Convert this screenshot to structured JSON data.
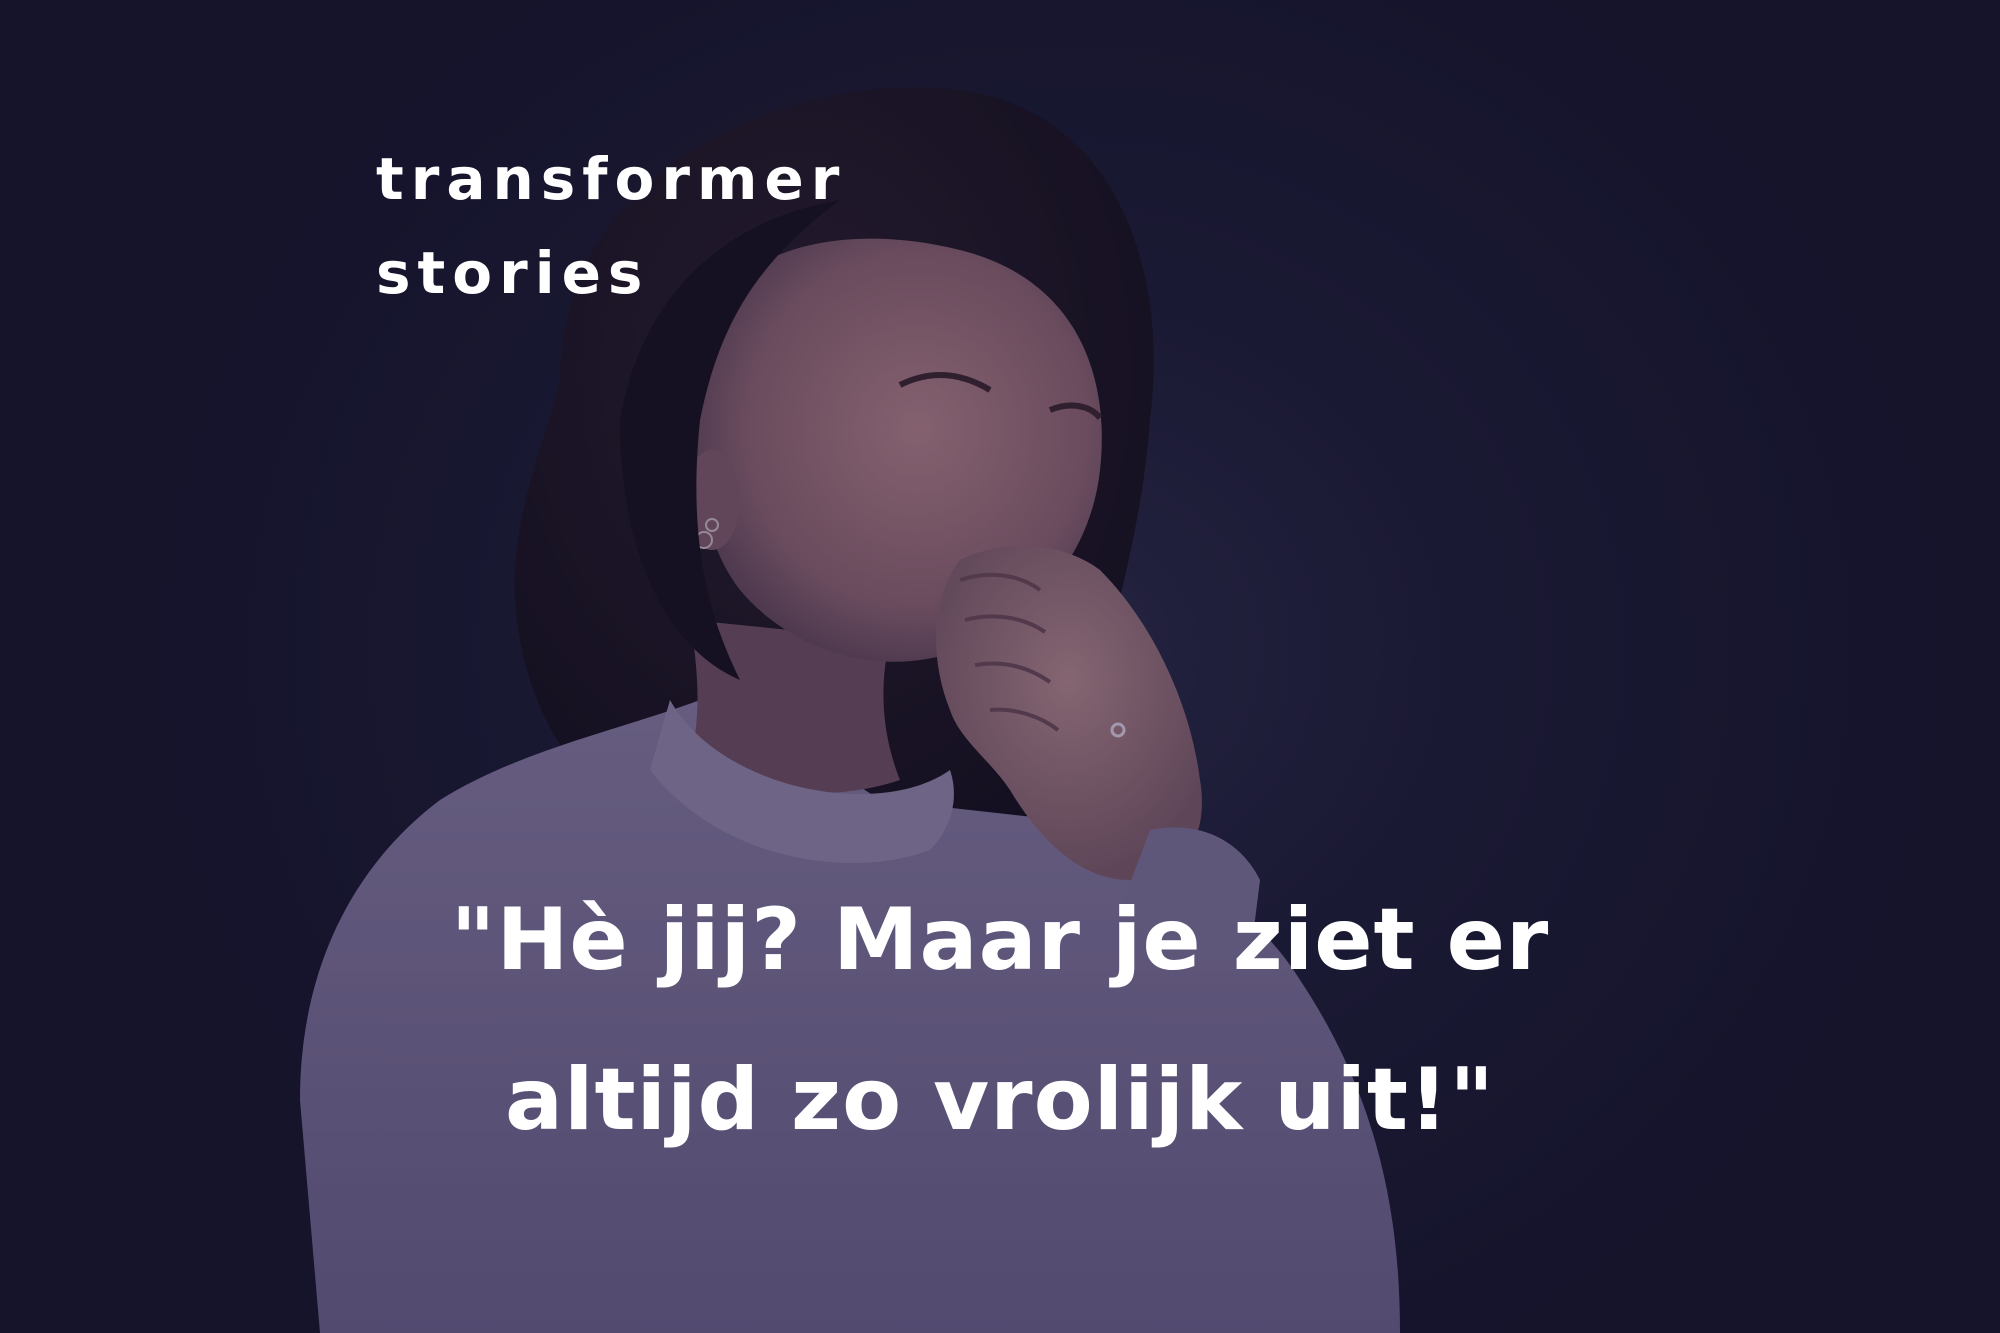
{
  "brand": {
    "line1": "transformer",
    "line2": "stories"
  },
  "quote": {
    "line1": "\"Hè jij? Maar je ziet er",
    "line2": "altijd zo vrolijk uit!\""
  },
  "colors": {
    "background": "#1d1d36",
    "sweater": "#7e7298",
    "skin": "#9a6f78",
    "hair": "#1a1422",
    "text": "#ffffff"
  }
}
